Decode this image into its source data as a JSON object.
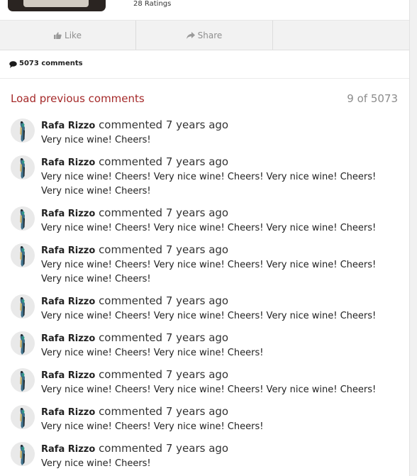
{
  "product": {
    "ratings": "28 Ratings"
  },
  "actions": {
    "like": "Like",
    "share": "Share"
  },
  "comments_count": "5073 comments",
  "load_previous": "Load previous comments",
  "pager": "9 of 5073",
  "comments": [
    {
      "author": "Rafa Rizzo",
      "meta": "commented 7 years ago",
      "text": "Very nice wine! Cheers!"
    },
    {
      "author": "Rafa Rizzo",
      "meta": "commented 7 years ago",
      "text": "Very nice wine! Cheers! Very nice wine! Cheers! Very nice wine! Cheers! Very nice wine! Cheers!"
    },
    {
      "author": "Rafa Rizzo",
      "meta": "commented 7 years ago",
      "text": "Very nice wine! Cheers! Very nice wine! Cheers! Very nice wine! Cheers!"
    },
    {
      "author": "Rafa Rizzo",
      "meta": "commented 7 years ago",
      "text": "Very nice wine! Cheers! Very nice wine! Cheers! Very nice wine! Cheers! Very nice wine! Cheers!"
    },
    {
      "author": "Rafa Rizzo",
      "meta": "commented 7 years ago",
      "text": "Very nice wine! Cheers! Very nice wine! Cheers! Very nice wine! Cheers!"
    },
    {
      "author": "Rafa Rizzo",
      "meta": "commented 7 years ago",
      "text": "Very nice wine! Cheers! Very nice wine! Cheers!"
    },
    {
      "author": "Rafa Rizzo",
      "meta": "commented 7 years ago",
      "text": "Very nice wine! Cheers! Very nice wine! Cheers! Very nice wine! Cheers!"
    },
    {
      "author": "Rafa Rizzo",
      "meta": "commented 7 years ago",
      "text": "Very nice wine! Cheers! Very nice wine! Cheers!"
    },
    {
      "author": "Rafa Rizzo",
      "meta": "commented 7 years ago",
      "text": "Very nice wine! Cheers!"
    }
  ],
  "icons": {
    "like": "thumbs-up-icon",
    "share": "share-arrow-icon",
    "comments": "speech-bubble-icon"
  },
  "colors": {
    "accent": "#a52a2a",
    "muted": "#8c8c8c",
    "action_bar": "#f2f2f2"
  }
}
